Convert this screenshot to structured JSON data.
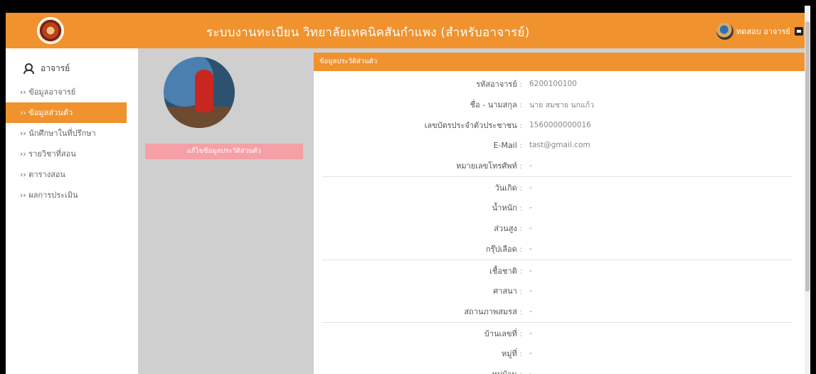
{
  "app": {
    "title": "ระบบงานทะเบียน วิทยาลัยเทคนิคสันกำแพง (สำหรับอาจารย์)"
  },
  "topbar": {
    "user_name": "ทดสอบ อาจารย์",
    "logo_icon": "college-seal-icon",
    "logout_icon": "logout-icon"
  },
  "sidebar": {
    "role_label": "อาจารย์",
    "items": [
      {
        "label": "›› ข้อมูลอาจารย์"
      },
      {
        "label": "›› ข้อมูลส่วนตัว"
      },
      {
        "label": "›› นักศึกษาในที่ปรึกษา"
      },
      {
        "label": "›› รายวิชาที่สอน"
      },
      {
        "label": "›› ตารางสอน"
      },
      {
        "label": "›› ผลการประเมิน"
      }
    ],
    "active_index": 1
  },
  "profile": {
    "edit_button_label": "แก้ไขข้อมูลประวัติส่วนตัว"
  },
  "card": {
    "header": "ข้อมูลประวัติส่วนตัว",
    "group1": [
      {
        "label": "รหัสอาจารย์",
        "value": "6200100100"
      },
      {
        "label": "ชื่อ - นามสกุล",
        "value": "นาย สมชาย นกแก้ว"
      },
      {
        "label": "เลขบัตรประจำตัวประชาชน",
        "value": "1560000000016"
      },
      {
        "label": "E-Mail",
        "value": "tast@gmail.com"
      },
      {
        "label": "หมายเลขโทรศัพท์",
        "value": "-"
      }
    ],
    "group2": [
      {
        "label": "วันเกิด",
        "value": "-"
      },
      {
        "label": "น้ำหนัก",
        "value": "-"
      },
      {
        "label": "ส่วนสูง",
        "value": "-"
      },
      {
        "label": "กรุ๊ปเลือด",
        "value": "-"
      }
    ],
    "group3": [
      {
        "label": "เชื้อชาติ",
        "value": "-"
      },
      {
        "label": "ศาสนา",
        "value": "-"
      },
      {
        "label": "สถานภาพสมรส",
        "value": "-"
      }
    ],
    "group4": [
      {
        "label": "บ้านเลขที่",
        "value": "-"
      },
      {
        "label": "หมู่ที่",
        "value": "-"
      },
      {
        "label": "หมู่บ้าน",
        "value": "-"
      }
    ]
  },
  "colors": {
    "accent": "#f0922e",
    "button": "#f5a0a6",
    "background": "#cfcfcf"
  }
}
